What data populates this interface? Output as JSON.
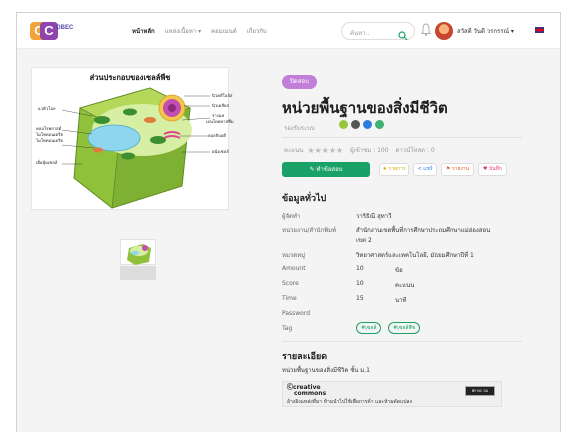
{
  "header": {
    "logo_letters": [
      "C",
      "C"
    ],
    "logo_text": "OBEC",
    "nav": [
      {
        "label": "หน้าหลัก",
        "active": true
      },
      {
        "label": "แหล่งเนื้อหา ▾",
        "active": false
      },
      {
        "label": "คอมเมนต์",
        "active": false
      },
      {
        "label": "เกี่ยวกับ",
        "active": false
      }
    ],
    "search_placeholder": "ค้นหา..",
    "user_name": "สวัสดี วันดี วรกรรณ์ ▾"
  },
  "media": {
    "image_title": "ส่วนประกอบของเซลล์พืช",
    "left_labels": [
      "แวคิวโอล",
      "คลอโรพลาสต์",
      "ไมโทคอนเดรีย",
      "ไมโทคอนเดรีย",
      "เยื่อหุ้มเซลล์"
    ],
    "right_labels": [
      "นิวคลีโอลัส",
      "นิวเคลียส",
      "ร่างแห",
      "เอนโดพลาสซึม",
      "กอลจิบอดี",
      "ผนังเซลล์"
    ]
  },
  "details": {
    "badge": "ปิดสอบ",
    "title": "หน่วยพื้นฐานของสิ่งมีชีวิต",
    "platform_label": "รองรับระบบ",
    "rating_label": "คะแนน",
    "stars": "★★★★★",
    "views": "ผู้เข้าชม : 100",
    "downloads": "ดาวน์โหลด : 0",
    "actions": {
      "main": "ทำข้อสอบ",
      "favorite": "★ รายการ",
      "share": "< แชร์",
      "report": "⚑ รายงาน",
      "bookmark": "♥ บันทึก"
    },
    "general_heading": "ข้อมูลทั่วไป",
    "info": [
      {
        "k": "ผู้จัดทำ",
        "v": "วาริธิณี สุทาวี",
        "u": ""
      },
      {
        "k": "หน่วยงาน/สำนักพิมพ์",
        "v": "สำนักงานเขตพื้นที่การศึกษาประถมศึกษาแม่ฮ่องสอน",
        "u": ""
      },
      {
        "k": "",
        "v": "เขต 2",
        "u": ""
      },
      {
        "k": "หมวดหมู่",
        "v": "วิทยาศาสตร์และเทคโนโลยี, มัธยมศึกษาปีที่ 1",
        "u": ""
      },
      {
        "k": "Amount",
        "v": "10",
        "u": "ข้อ"
      },
      {
        "k": "Score",
        "v": "10",
        "u": "คะแนน"
      },
      {
        "k": "Time",
        "v": "15",
        "u": "นาที"
      },
      {
        "k": "Password",
        "v": "",
        "u": ""
      },
      {
        "k": "Tag",
        "v": "",
        "u": ""
      }
    ],
    "tags": [
      "#เซลล์",
      "#เซลล์พืช"
    ],
    "description_heading": "รายละเอียด",
    "description": "หน่วยพื้นฐานของสิ่งมีชีวิต ชั้น ม.1",
    "cc_logo_line1": "creative",
    "cc_logo_line2": "commons",
    "cc_badge": "BY NC SA",
    "cc_text": "อ้างอิงแหล่งที่มา ห้ามนำไปใช้เพื่อการค้า และห้ามดัดแปลง"
  },
  "colors": {
    "accent_green": "#1aa168",
    "badge_purple": "#c27fd8",
    "logo_orange": "#f2a33a",
    "logo_purple": "#8e44ad"
  }
}
